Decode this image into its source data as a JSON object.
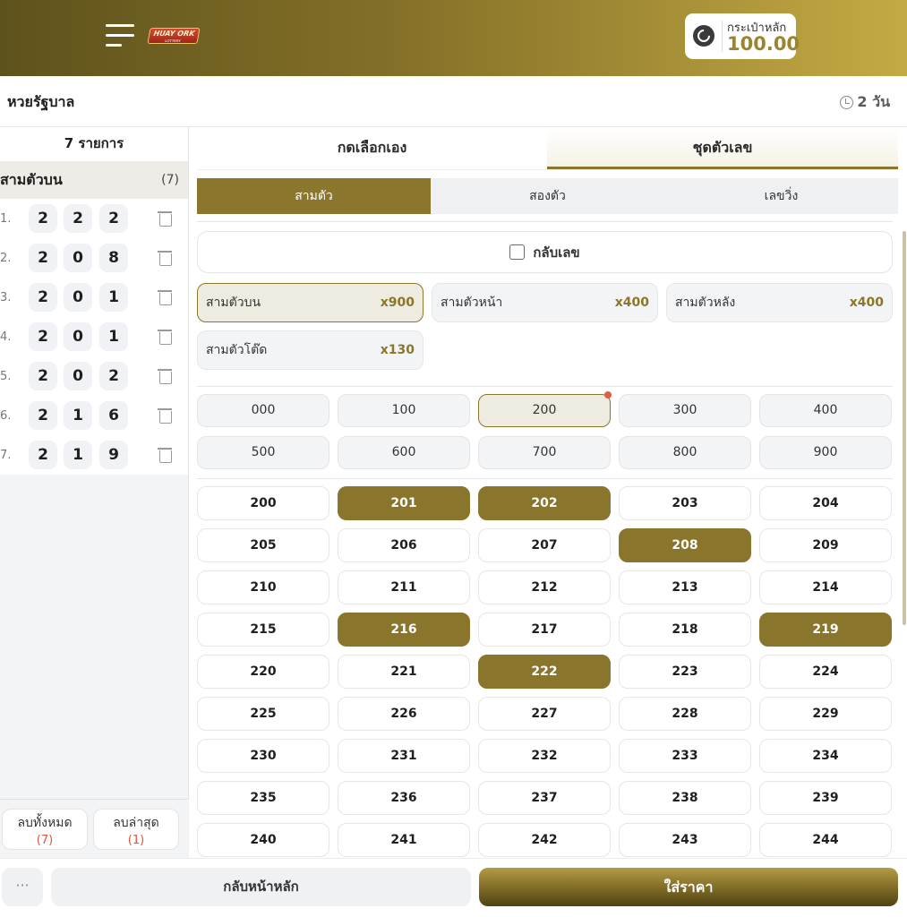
{
  "header": {
    "logo_text": "HUAY ORK",
    "logo_sub": "LOTTERY",
    "wallet_label": "กระเป๋าหลัก",
    "wallet_amount": "100.00"
  },
  "subheader": {
    "title": "หวยรัฐบาล",
    "time_left": "2 วัน"
  },
  "left": {
    "count_title": "7 รายการ",
    "group_name": "สามตัวบน",
    "group_count": "(7)",
    "bets": [
      {
        "idx": "1.",
        "d": [
          "2",
          "2",
          "2"
        ]
      },
      {
        "idx": "2.",
        "d": [
          "2",
          "0",
          "8"
        ]
      },
      {
        "idx": "3.",
        "d": [
          "2",
          "0",
          "1"
        ]
      },
      {
        "idx": "4.",
        "d": [
          "2",
          "0",
          "1"
        ]
      },
      {
        "idx": "5.",
        "d": [
          "2",
          "0",
          "2"
        ]
      },
      {
        "idx": "6.",
        "d": [
          "2",
          "1",
          "6"
        ]
      },
      {
        "idx": "7.",
        "d": [
          "2",
          "1",
          "9"
        ]
      }
    ],
    "clear_all_label": "ลบทั้งหมด",
    "clear_all_count": "(7)",
    "clear_last_label": "ลบล่าสุด",
    "clear_last_count": "(1)"
  },
  "mode_tabs": [
    "กดเลือกเอง",
    "ชุดตัวเลข"
  ],
  "active_mode": 1,
  "type_tabs": [
    "สามตัว",
    "สองตัว",
    "เลขวิ่ง"
  ],
  "active_type": 0,
  "reverse_label": "กลับเลข",
  "reverse_checked": false,
  "rates": [
    {
      "name": "สามตัวบน",
      "mult": "x900"
    },
    {
      "name": "สามตัวหน้า",
      "mult": "x400"
    },
    {
      "name": "สามตัวหลัง",
      "mult": "x400"
    },
    {
      "name": "สามตัวโต๊ด",
      "mult": "x130"
    }
  ],
  "active_rate": 0,
  "hundreds": [
    "000",
    "100",
    "200",
    "300",
    "400",
    "500",
    "600",
    "700",
    "800",
    "900"
  ],
  "active_hundred": "200",
  "numbers": [
    "200",
    "201",
    "202",
    "203",
    "204",
    "205",
    "206",
    "207",
    "208",
    "209",
    "210",
    "211",
    "212",
    "213",
    "214",
    "215",
    "216",
    "217",
    "218",
    "219",
    "220",
    "221",
    "222",
    "223",
    "224",
    "225",
    "226",
    "227",
    "228",
    "229",
    "230",
    "231",
    "232",
    "233",
    "234",
    "235",
    "236",
    "237",
    "238",
    "239",
    "240",
    "241",
    "242",
    "243",
    "244"
  ],
  "selected_numbers": [
    "201",
    "202",
    "208",
    "216",
    "219",
    "222"
  ],
  "bottom": {
    "more_label": "···",
    "home_label": "กลับหน้าหลัก",
    "price_label": "ใส่ราคา"
  },
  "colors": {
    "accent": "#8a762c",
    "header_start": "#5e521c",
    "header_end": "#c4aa45",
    "danger": "#e0533d"
  }
}
